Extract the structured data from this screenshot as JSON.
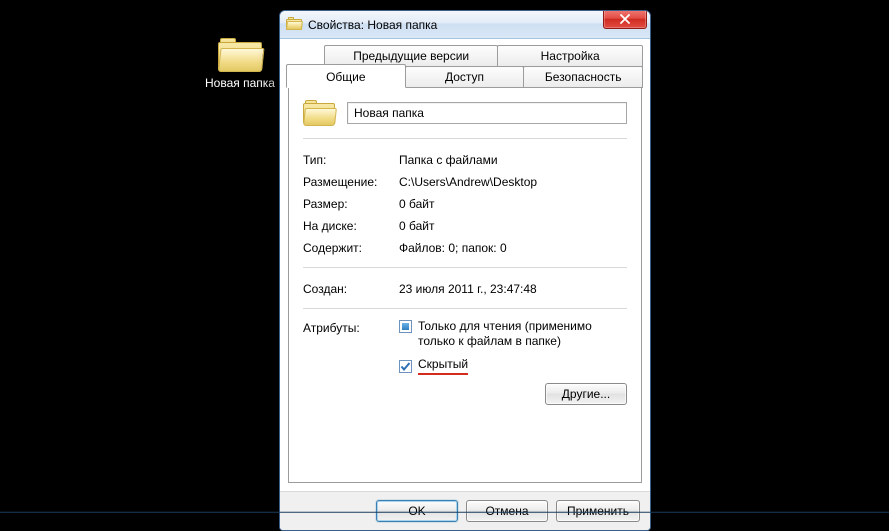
{
  "desktop": {
    "icon_label": "Новая папка"
  },
  "dialog": {
    "title": "Свойства: Новая папка",
    "tabs": {
      "back": [
        "Предыдущие версии",
        "Настройка"
      ],
      "front": [
        "Общие",
        "Доступ",
        "Безопасность"
      ],
      "active": "Общие"
    },
    "folder_name": "Новая папка",
    "rows": {
      "type_label": "Тип:",
      "type_value": "Папка с файлами",
      "location_label": "Размещение:",
      "location_value": "C:\\Users\\Andrew\\Desktop",
      "size_label": "Размер:",
      "size_value": "0 байт",
      "ondisk_label": "На диске:",
      "ondisk_value": "0 байт",
      "contains_label": "Содержит:",
      "contains_value": "Файлов: 0; папок: 0",
      "created_label": "Создан:",
      "created_value": "23 июля 2011 г., 23:47:48"
    },
    "attributes": {
      "label": "Атрибуты:",
      "readonly_label": "Только для чтения (применимо только к файлам в папке)",
      "readonly_state": "mixed",
      "hidden_label": "Скрытый",
      "hidden_state": "checked",
      "others_button": "Другие..."
    },
    "buttons": {
      "ok": "OK",
      "cancel": "Отмена",
      "apply": "Применить"
    }
  }
}
